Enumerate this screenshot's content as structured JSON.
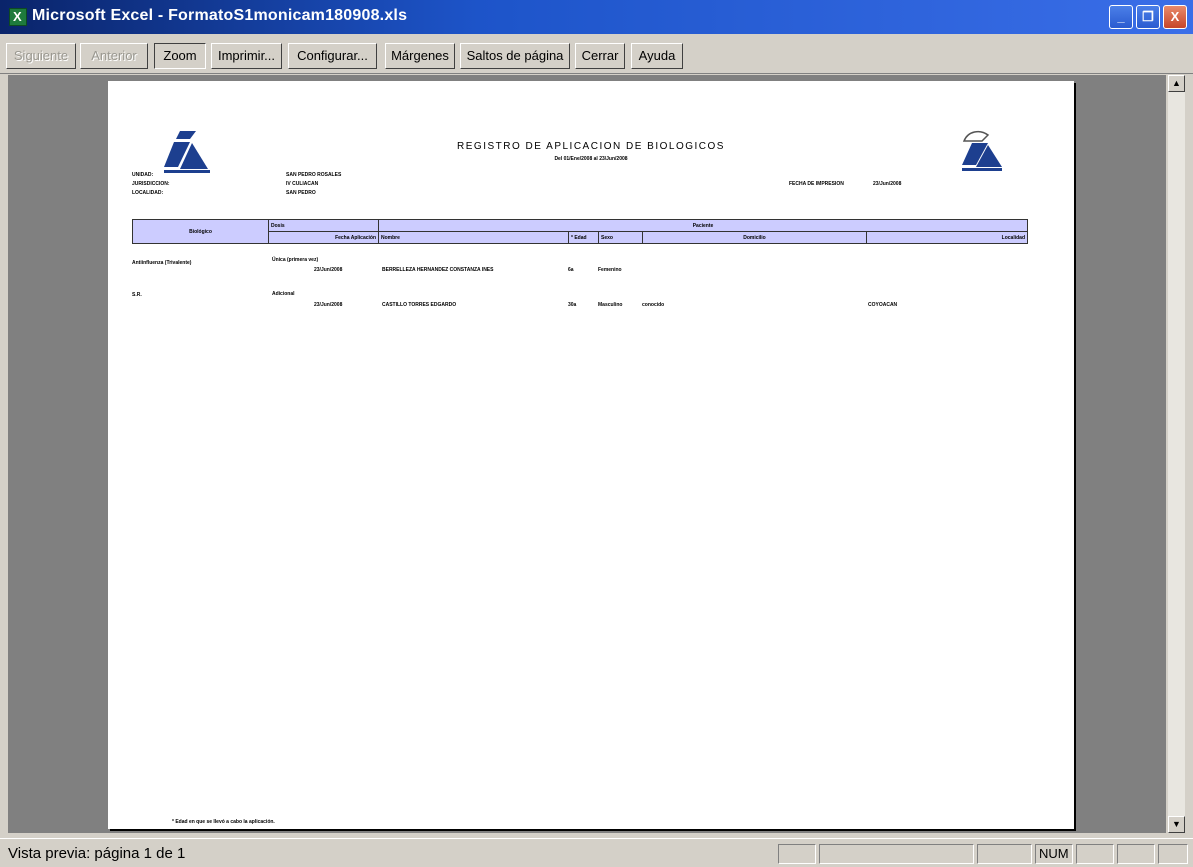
{
  "window": {
    "title": "Microsoft Excel - FormatoS1monicam180908.xls",
    "controls": [
      "_",
      "❐",
      "X"
    ]
  },
  "toolbar": {
    "buttons": [
      {
        "label": "Siguiente",
        "state": "disabled"
      },
      {
        "label": "Anterior",
        "state": "disabled"
      },
      {
        "label": "Zoom",
        "state": "pressed"
      },
      {
        "label": "Imprimir...",
        "state": "normal"
      },
      {
        "label": "Configurar...",
        "state": "normal"
      },
      {
        "label": "Márgenes",
        "state": "normal"
      },
      {
        "label": "Saltos de página",
        "state": "normal"
      },
      {
        "label": "Cerrar",
        "state": "normal"
      },
      {
        "label": "Ayuda",
        "state": "normal"
      }
    ]
  },
  "report": {
    "title": "REGISTRO DE APLICACION DE BIOLOGICOS",
    "subtitle": "Del 01/Ene/2008 al 23/Jun/2008",
    "unidad_label": "UNIDAD:",
    "unidad_value": "SAN PEDRO ROSALES",
    "jurisdiccion_label": "JURISDICCION:",
    "jurisdiccion_value": "IV CULIACAN",
    "localidad_label": "LOCALIDAD:",
    "localidad_value": "SAN PEDRO",
    "fecha_label": "FECHA DE IMPRESION",
    "fecha_value": "23/Jun/2008",
    "table": {
      "col_biologico": "Biológico",
      "col_dosis": "Dosis",
      "col_fecha": "Fecha Aplicación",
      "col_paciente": "Paciente",
      "col_nombre": "Nombre",
      "col_edad": "* Edad",
      "col_sexo": "Sexo",
      "col_domicilio": "Domicilio",
      "col_localidad": "Localidad"
    },
    "rows": [
      {
        "biologico": "Antiinfluenza (Trivalente)",
        "dosis": "Única (primera vez)",
        "fecha": "23/Jun/2008",
        "nombre": "BERRELLEZA HERNANDEZ CONSTANZA INES",
        "edad": "6a",
        "sexo": "Femenino",
        "domicilio": "",
        "localidad": ""
      },
      {
        "biologico": "S.R.",
        "dosis": "Adicional",
        "fecha": "23/Jun/2008",
        "nombre": "CASTILLO TORRES EDGARDO",
        "edad": "30a",
        "sexo": "Masculino",
        "domicilio": "conocido",
        "localidad": "COYOACAN"
      }
    ],
    "footnote": "* Edad en que se llevó a cabo la aplicación."
  },
  "status": {
    "text": "Vista previa: página 1 de 1",
    "num": "NUM"
  }
}
